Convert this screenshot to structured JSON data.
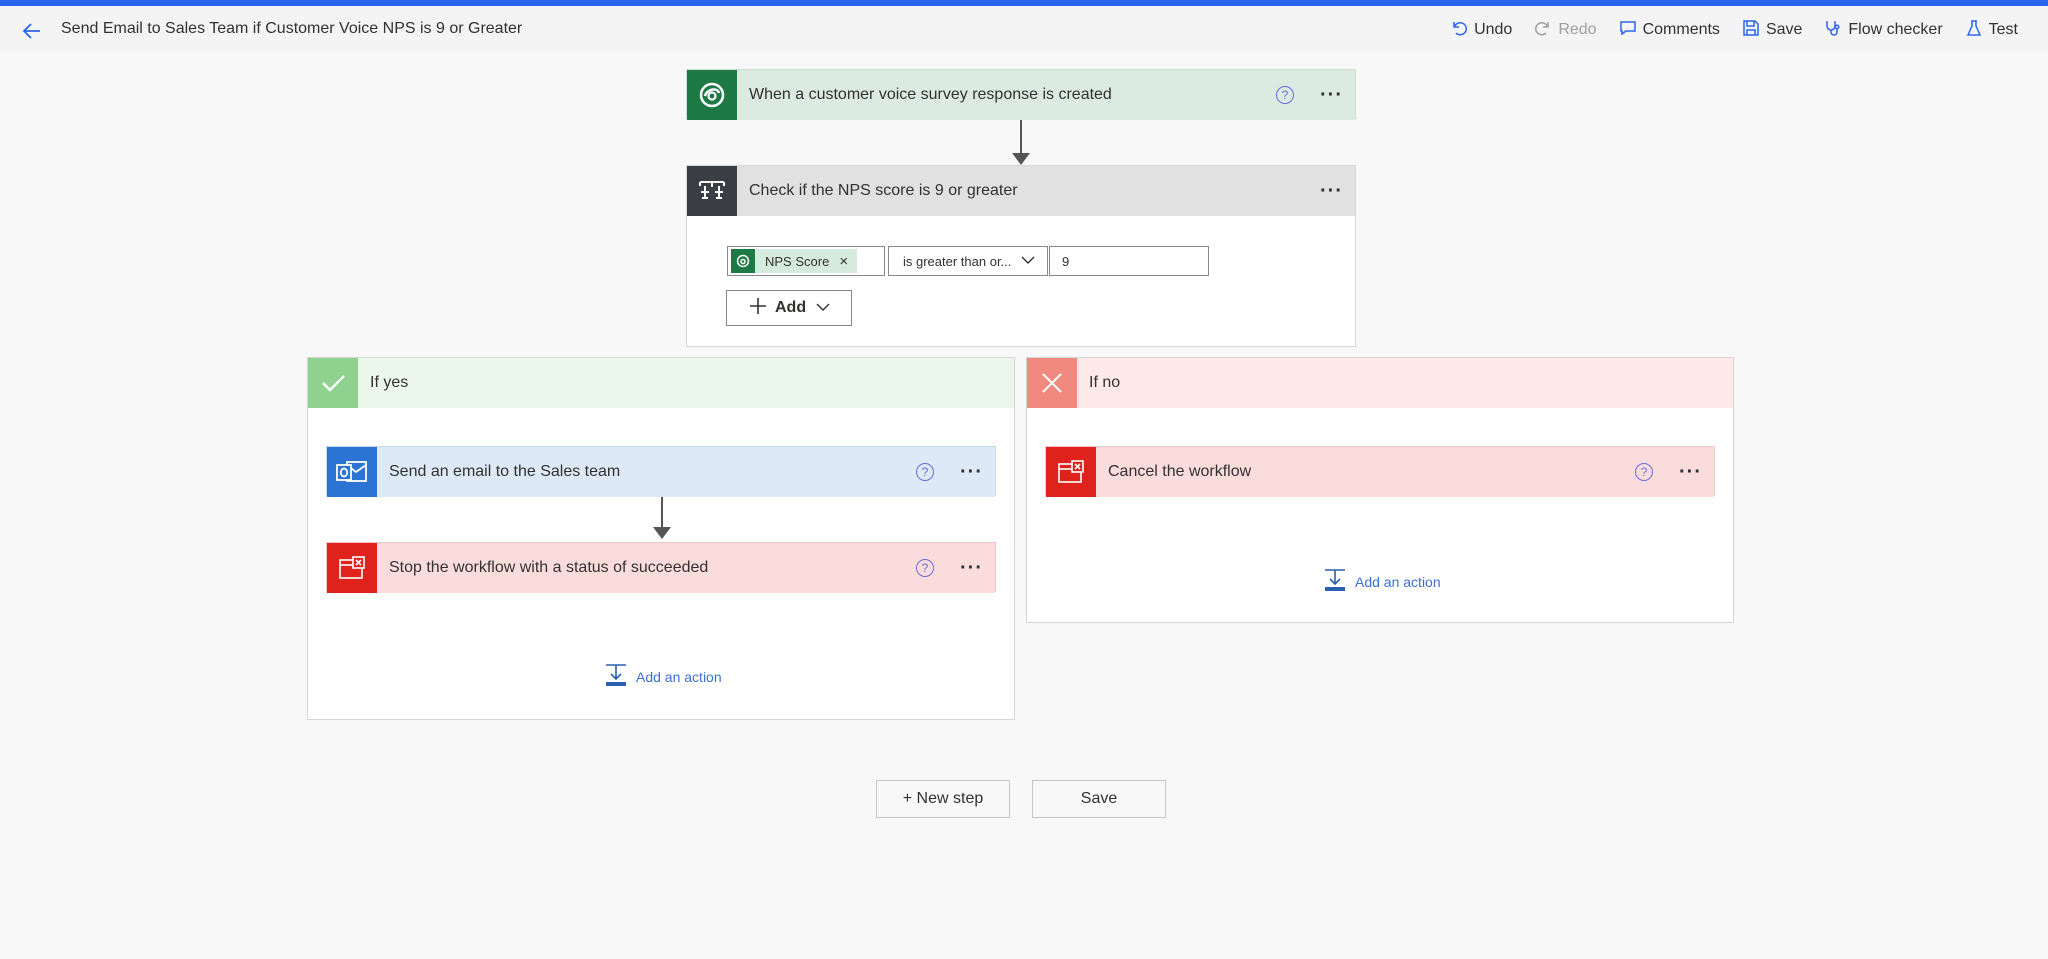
{
  "header": {
    "title": "Send Email to Sales Team if Customer Voice NPS is 9 or Greater",
    "toolbar": {
      "undo": "Undo",
      "redo": "Redo",
      "comments": "Comments",
      "save": "Save",
      "flow_checker": "Flow checker",
      "test": "Test"
    }
  },
  "trigger": {
    "title": "When a customer voice survey response is created",
    "help": "?",
    "more": "···"
  },
  "condition": {
    "title": "Check if the NPS score is 9 or greater",
    "more": "···",
    "token_label": "NPS Score",
    "token_remove": "×",
    "operator": "is greater than or...",
    "value": "9",
    "add_label": "Add"
  },
  "branch_yes": {
    "title": "If yes",
    "steps": [
      {
        "title": "Send an email to the Sales team",
        "help": "?",
        "more": "···"
      },
      {
        "title": "Stop the workflow with a status of succeeded",
        "help": "?",
        "more": "···"
      }
    ],
    "add_action": "Add an action"
  },
  "branch_no": {
    "title": "If no",
    "steps": [
      {
        "title": "Cancel the workflow",
        "help": "?",
        "more": "···"
      }
    ],
    "add_action": "Add an action"
  },
  "footer": {
    "new_step": "+ New step",
    "save": "Save"
  },
  "colors": {
    "accent": "#2b64ee",
    "trigger_icon": "#1e7a45",
    "trigger_head": "#dcebe2",
    "condition_icon": "#3b3f45",
    "condition_head": "#e1e1e1",
    "yes_icon": "#8fd18f",
    "yes_head": "#ecf7ec",
    "no_icon": "#f08a80",
    "no_head": "#fde9e8",
    "outlook_icon": "#2b74d4",
    "outlook_head": "#dde9f6",
    "stop_icon": "#e0221c",
    "stop_head": "#fbdcdc"
  }
}
